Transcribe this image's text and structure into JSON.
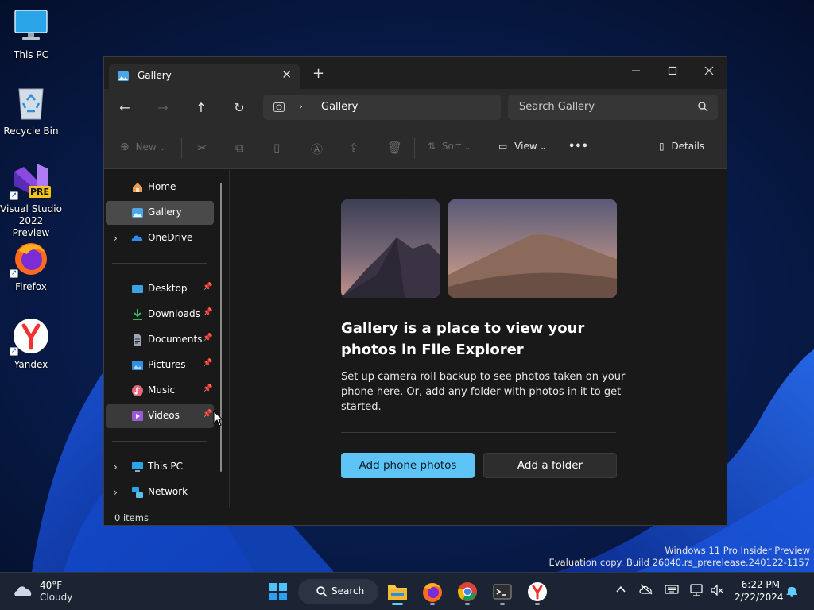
{
  "desktop": {
    "icons": [
      {
        "label": "This PC"
      },
      {
        "label": "Recycle Bin"
      },
      {
        "label": "Visual Studio 2022 Preview",
        "badge": "PRE"
      },
      {
        "label": "Firefox"
      },
      {
        "label": "Yandex"
      }
    ],
    "watermark": {
      "line1": "Windows 11 Pro Insider Preview",
      "line2": "Evaluation copy. Build 26040.rs_prerelease.240122-1157"
    }
  },
  "explorer": {
    "tab_title": "Gallery",
    "address": {
      "crumb": "Gallery"
    },
    "search_placeholder": "Search Gallery",
    "commands": {
      "new": "New",
      "sort": "Sort",
      "view": "View",
      "more": "•••",
      "details": "Details"
    },
    "nav": {
      "home": "Home",
      "gallery": "Gallery",
      "onedrive": "OneDrive",
      "desktop": "Desktop",
      "downloads": "Downloads",
      "documents": "Documents",
      "pictures": "Pictures",
      "music": "Music",
      "videos": "Videos",
      "thispc": "This PC",
      "network": "Network"
    },
    "content": {
      "heading": "Gallery is a place to view your photos in File Explorer",
      "description": "Set up camera roll backup to see photos taken on your phone here. Or, add any folder with photos in it to get started.",
      "primary_button": "Add phone photos",
      "secondary_button": "Add a folder"
    },
    "status": "0 items"
  },
  "taskbar": {
    "weather": {
      "temp": "40°F",
      "condition": "Cloudy"
    },
    "search_label": "Search",
    "clock": {
      "time": "6:22 PM",
      "date": "2/22/2024"
    }
  },
  "colors": {
    "accent": "#5ec3f5",
    "window_bg": "#191919",
    "chrome_bg": "#2b2b2b",
    "taskbar_bg": "#1c2433"
  }
}
